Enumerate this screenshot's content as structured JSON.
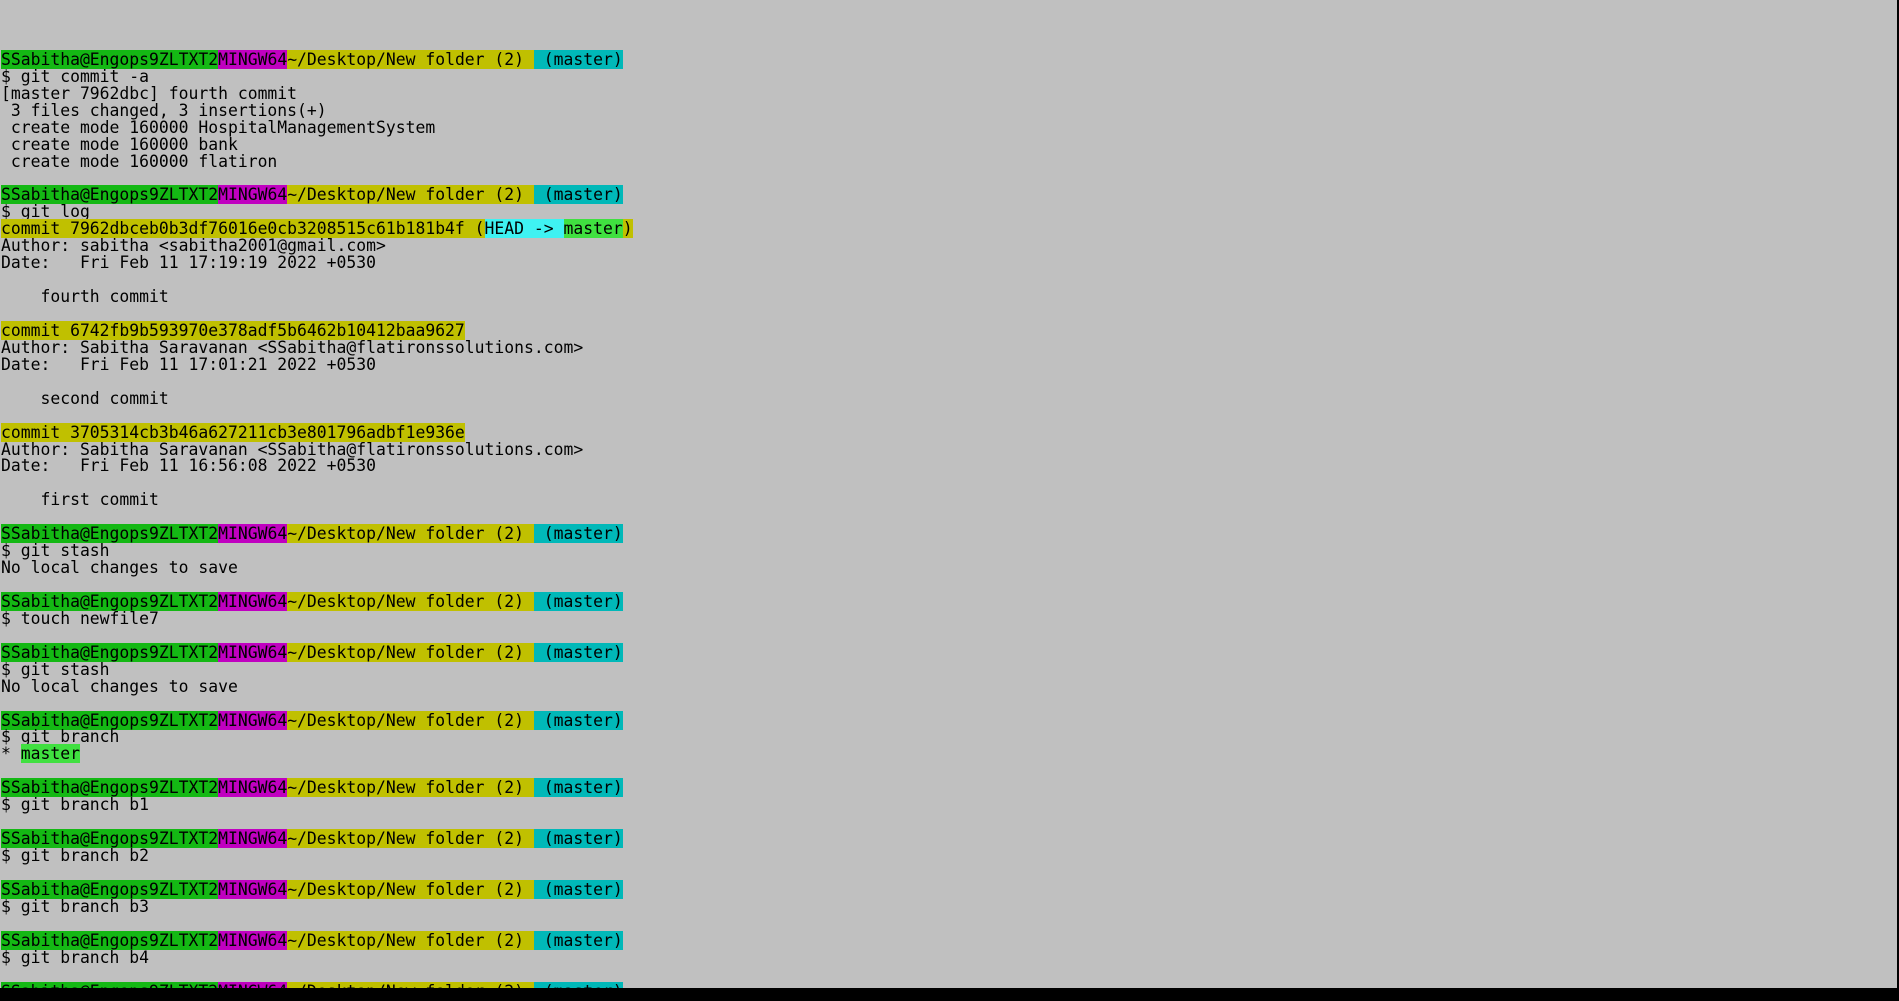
{
  "prompt": {
    "user": "SSabitha@Engops9ZLTXT2",
    "system": "MINGW64",
    "path": "~/Desktop/New folder (2)",
    "branch": "(master)"
  },
  "colors": {
    "window_background": "#c0c0c0",
    "prompt_user_background": "#14b814",
    "prompt_system_background": "#c000c0",
    "prompt_path_background": "#c0c000",
    "prompt_branch_background": "#00b8b8",
    "commit_hash_background": "#c0c000",
    "head_ref_background": "#3ff2f2",
    "current_branch_background": "#40e040"
  },
  "lines": [
    {
      "kind": "blank"
    },
    {
      "kind": "prompt"
    },
    {
      "kind": "text",
      "text": "$ git commit -a"
    },
    {
      "kind": "text",
      "text": "[master 7962dbc] fourth commit"
    },
    {
      "kind": "text",
      "text": " 3 files changed, 3 insertions(+)"
    },
    {
      "kind": "text",
      "text": " create mode 160000 HospitalManagementSystem"
    },
    {
      "kind": "text",
      "text": " create mode 160000 bank"
    },
    {
      "kind": "text",
      "text": " create mode 160000 flatiron"
    },
    {
      "kind": "blank"
    },
    {
      "kind": "prompt"
    },
    {
      "kind": "text",
      "text": "$ git log"
    },
    {
      "kind": "commit_head",
      "commit": "commit 7962dbceb0b3df76016e0cb3208515c61b181b4f",
      "open": " (",
      "head": "HEAD -> ",
      "branch": "master",
      "close": ")"
    },
    {
      "kind": "text",
      "text": "Author: sabitha <sabitha2001@gmail.com>"
    },
    {
      "kind": "text",
      "text": "Date:   Fri Feb 11 17:19:19 2022 +0530"
    },
    {
      "kind": "blank"
    },
    {
      "kind": "text",
      "text": "    fourth commit"
    },
    {
      "kind": "blank"
    },
    {
      "kind": "commit",
      "text": "commit 6742fb9b593970e378adf5b6462b10412baa9627"
    },
    {
      "kind": "text",
      "text": "Author: Sabitha Saravanan <SSabitha@flatironssolutions.com>"
    },
    {
      "kind": "text",
      "text": "Date:   Fri Feb 11 17:01:21 2022 +0530"
    },
    {
      "kind": "blank"
    },
    {
      "kind": "text",
      "text": "    second commit"
    },
    {
      "kind": "blank"
    },
    {
      "kind": "commit",
      "text": "commit 3705314cb3b46a627211cb3e801796adbf1e936e"
    },
    {
      "kind": "text",
      "text": "Author: Sabitha Saravanan <SSabitha@flatironssolutions.com>"
    },
    {
      "kind": "text",
      "text": "Date:   Fri Feb 11 16:56:08 2022 +0530"
    },
    {
      "kind": "blank"
    },
    {
      "kind": "text",
      "text": "    first commit"
    },
    {
      "kind": "blank"
    },
    {
      "kind": "prompt"
    },
    {
      "kind": "text",
      "text": "$ git stash"
    },
    {
      "kind": "text",
      "text": "No local changes to save"
    },
    {
      "kind": "blank"
    },
    {
      "kind": "prompt"
    },
    {
      "kind": "text",
      "text": "$ touch newfile7"
    },
    {
      "kind": "blank"
    },
    {
      "kind": "prompt"
    },
    {
      "kind": "text",
      "text": "$ git stash"
    },
    {
      "kind": "text",
      "text": "No local changes to save"
    },
    {
      "kind": "blank"
    },
    {
      "kind": "prompt"
    },
    {
      "kind": "text",
      "text": "$ git branch"
    },
    {
      "kind": "branch_item",
      "marker": "* ",
      "name": "master"
    },
    {
      "kind": "blank"
    },
    {
      "kind": "prompt"
    },
    {
      "kind": "text",
      "text": "$ git branch b1"
    },
    {
      "kind": "blank"
    },
    {
      "kind": "prompt"
    },
    {
      "kind": "text",
      "text": "$ git branch b2"
    },
    {
      "kind": "blank"
    },
    {
      "kind": "prompt"
    },
    {
      "kind": "text",
      "text": "$ git branch b3"
    },
    {
      "kind": "blank"
    },
    {
      "kind": "prompt"
    },
    {
      "kind": "text",
      "text": "$ git branch b4"
    },
    {
      "kind": "blank"
    },
    {
      "kind": "prompt"
    }
  ]
}
